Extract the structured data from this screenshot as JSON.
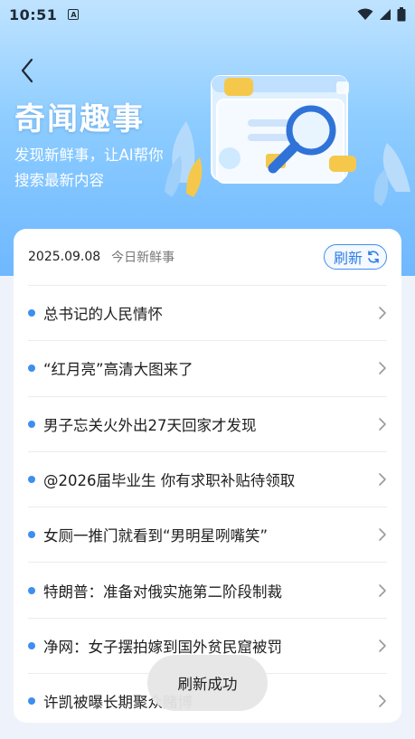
{
  "status_bar": {
    "time": "10:51",
    "notification_icon": "A"
  },
  "header": {
    "title": "奇闻趣事",
    "subtitle": "发现新鲜事，让AI帮你搜索最新内容"
  },
  "card": {
    "date": "2025.09.08",
    "today_label": "今日新鲜事",
    "refresh_label": "刷新"
  },
  "news_items": [
    {
      "title": "总书记的人民情怀"
    },
    {
      "title": "“红月亮”高清大图来了"
    },
    {
      "title": "男子忘关火外出27天回家才发现"
    },
    {
      "title": "@2026届毕业生 你有求职补贴待领取"
    },
    {
      "title": "女厕一推门就看到“男明星咧嘴笑”"
    },
    {
      "title": "特朗普：准备对俄实施第二阶段制裁"
    },
    {
      "title": "净网：女子摆拍嫁到国外贫民窟被罚"
    },
    {
      "title": "许凯被曝长期聚众赌博"
    }
  ],
  "toast": {
    "message": "刷新成功"
  },
  "colors": {
    "accent": "#3d8ef2",
    "hero_top": "#bfe3ff",
    "hero_bottom": "#6fb8ff"
  },
  "icons": {
    "back": "chevron-left-icon",
    "refresh": "refresh-icon",
    "row_arrow": "chevron-right-icon"
  }
}
